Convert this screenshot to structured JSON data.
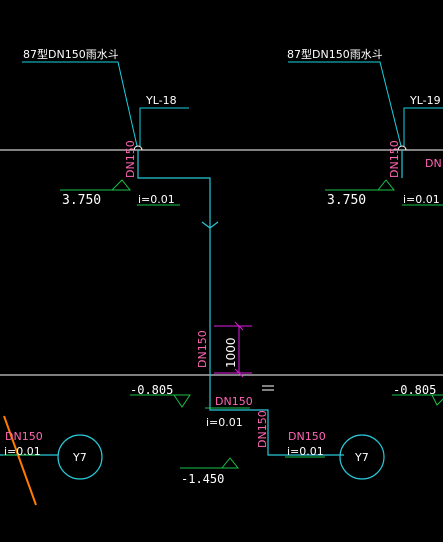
{
  "colors": {
    "background": "#000000",
    "pipe": "#29c9d9",
    "leader": "#18d2e0",
    "level_line": "#ffffff",
    "dn_label": "#ff66b3",
    "symbol": "#19c24a",
    "dim": "#e21be2",
    "note": "#ff7a00",
    "text": "#ffffff"
  },
  "labels": {
    "drain_left": "87型DN150雨水斗",
    "drain_right": "87型DN150雨水斗",
    "pipe_yl18": "YL-18",
    "pipe_yl19": "YL-19",
    "dn_riser_left": "DN150",
    "dn_riser_right": "DN150",
    "dn_right_partial": "DN",
    "dn_vertical_mid": "DN150",
    "dim_1000": "1000",
    "elev_375_left": "3.750",
    "elev_375_right": "3.750",
    "slope_top_left": "i=0.01",
    "slope_top_right": "i=0.01",
    "elev_0805_left": "-0.805",
    "elev_0805_right": "-0.805",
    "dn_mid_horizontal": "DN150",
    "slope_mid": "i=0.01",
    "dn_riser_down": "DN150",
    "dn_bottom_left": "DN150",
    "slope_bottom_left": "i=0.01",
    "dn_bottom_mid": "DN150",
    "slope_bottom_mid": "i=0.01",
    "manhole_left": "Y7",
    "manhole_right": "Y7",
    "elev_1450": "-1.450"
  }
}
